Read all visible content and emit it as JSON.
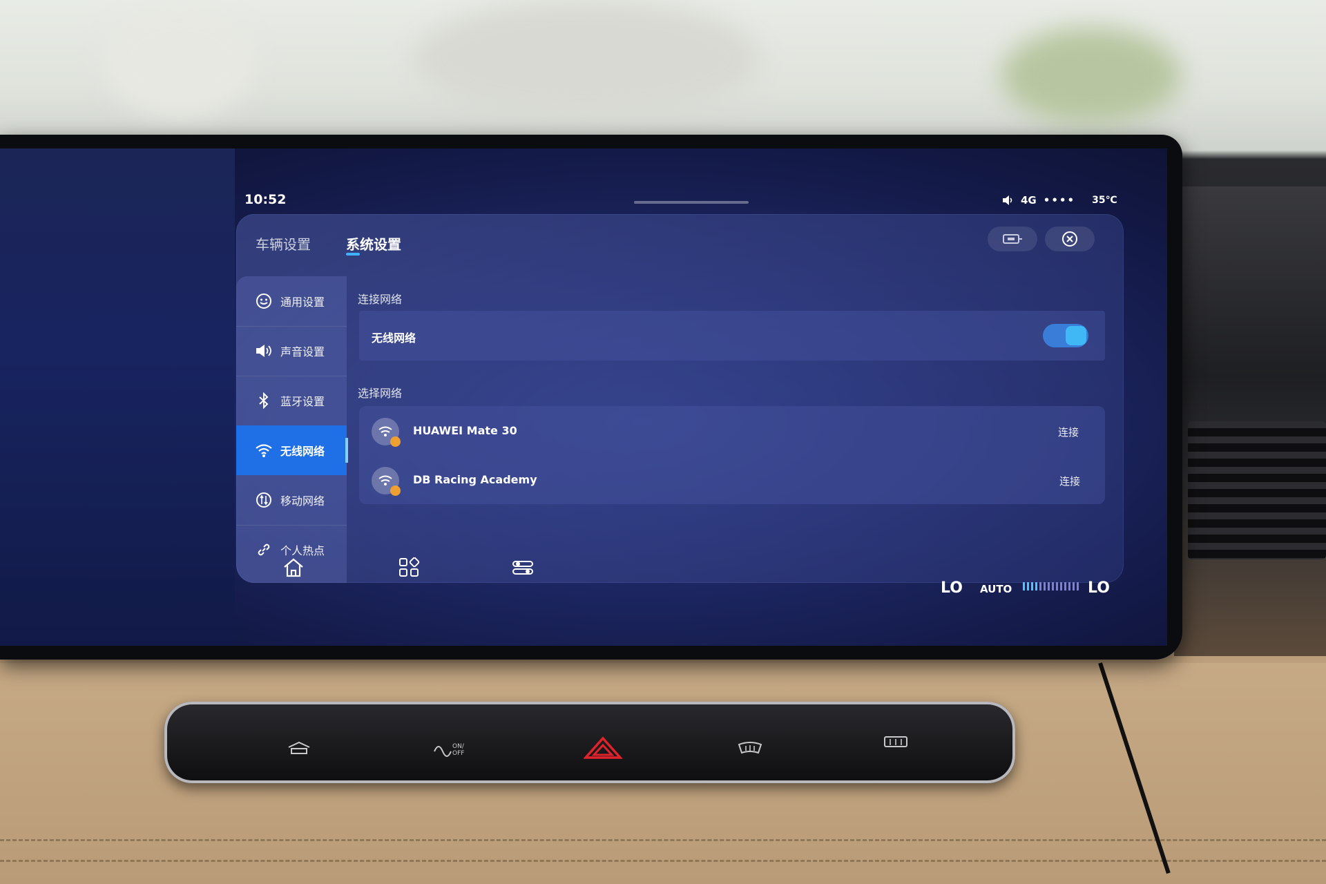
{
  "status": {
    "time": "10:52",
    "network": "4G",
    "signal_dots": "••••",
    "temperature": "35℃"
  },
  "tabs": [
    {
      "label": "车辆设置",
      "active": false
    },
    {
      "label": "系统设置",
      "active": true
    }
  ],
  "sidebar": {
    "items": [
      {
        "label": "通用设置",
        "icon": "settings-face-icon"
      },
      {
        "label": "声音设置",
        "icon": "speaker-icon"
      },
      {
        "label": "蓝牙设置",
        "icon": "bluetooth-icon"
      },
      {
        "label": "无线网络",
        "icon": "wifi-icon",
        "active": true
      },
      {
        "label": "移动网络",
        "icon": "mobile-network-icon"
      },
      {
        "label": "个人热点",
        "icon": "hotspot-link-icon"
      }
    ]
  },
  "main": {
    "connect_section": "连接网络",
    "wifi_row_label": "无线网络",
    "wifi_enabled": true,
    "select_section": "选择网络",
    "networks": [
      {
        "name": "HUAWEI Mate 30",
        "action": "连接"
      },
      {
        "name": "DB Racing Academy",
        "action": "连接"
      }
    ]
  },
  "climate": {
    "left_temp": "LO",
    "mode": "AUTO",
    "right_temp": "LO",
    "fan_level": 0.3
  },
  "colors": {
    "accent": "#1f6fe6",
    "toggle": "#40b8f5"
  }
}
